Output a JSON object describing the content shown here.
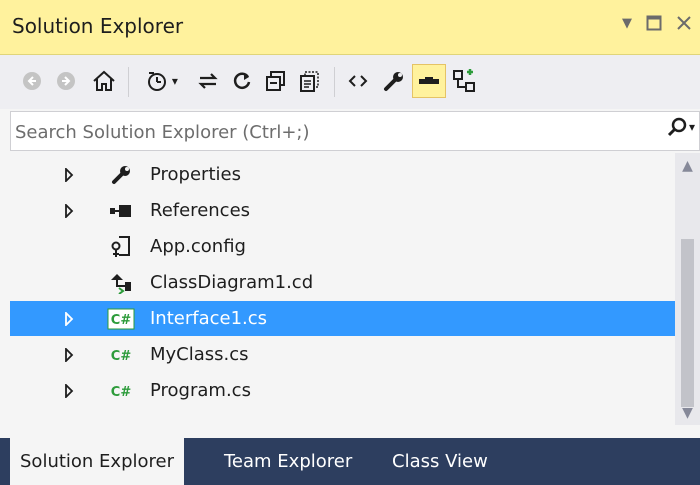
{
  "window": {
    "title": "Solution Explorer",
    "controls": {
      "dropdown": "▼",
      "maximize": "☐",
      "close": "✕"
    }
  },
  "toolbar": {
    "buttons": [
      {
        "name": "back-icon",
        "glyph": "◀",
        "state": "disabled"
      },
      {
        "name": "forward-icon",
        "glyph": "▶",
        "state": "disabled"
      },
      {
        "name": "home-icon",
        "glyph": "⌂",
        "state": "enabled"
      },
      {
        "name": "pending-changes-filter-icon",
        "glyph": "◷",
        "state": "enabled"
      },
      {
        "name": "sync-with-document-icon",
        "glyph": "⇄",
        "state": "enabled"
      },
      {
        "name": "refresh-icon",
        "glyph": "↻",
        "state": "enabled"
      },
      {
        "name": "collapse-all-icon",
        "glyph": "▣",
        "state": "enabled"
      },
      {
        "name": "show-all-files-icon",
        "glyph": "▤",
        "state": "enabled"
      },
      {
        "name": "view-code-icon",
        "glyph": "‹›",
        "state": "enabled"
      },
      {
        "name": "properties-wrench-icon",
        "glyph": "🔧",
        "state": "enabled"
      },
      {
        "name": "preview-selected-items-icon",
        "glyph": "▬",
        "state": "active"
      },
      {
        "name": "view-class-diagram-icon",
        "glyph": "⊞",
        "state": "enabled"
      }
    ]
  },
  "search": {
    "placeholder": "Search Solution Explorer (Ctrl+;)",
    "value": ""
  },
  "tree": {
    "items": [
      {
        "label": "Properties",
        "icon": "wrench-icon",
        "expandable": true,
        "selected": false
      },
      {
        "label": "References",
        "icon": "references-icon",
        "expandable": true,
        "selected": false
      },
      {
        "label": "App.config",
        "icon": "config-file-icon",
        "expandable": false,
        "selected": false
      },
      {
        "label": "ClassDiagram1.cd",
        "icon": "class-diagram-icon",
        "expandable": false,
        "selected": false
      },
      {
        "label": "Interface1.cs",
        "icon": "csharp-file-icon",
        "expandable": true,
        "selected": true
      },
      {
        "label": "MyClass.cs",
        "icon": "csharp-file-icon",
        "expandable": true,
        "selected": false
      },
      {
        "label": "Program.cs",
        "icon": "csharp-file-icon",
        "expandable": true,
        "selected": false
      }
    ]
  },
  "tabs": [
    {
      "label": "Solution Explorer",
      "active": true
    },
    {
      "label": "Team Explorer",
      "active": false
    },
    {
      "label": "Class View",
      "active": false
    }
  ],
  "colors": {
    "title_bg": "#fff29d",
    "selection": "#3399ff",
    "tabbar_bg": "#2d3e5f",
    "csharp_green": "#2c9b3a"
  }
}
